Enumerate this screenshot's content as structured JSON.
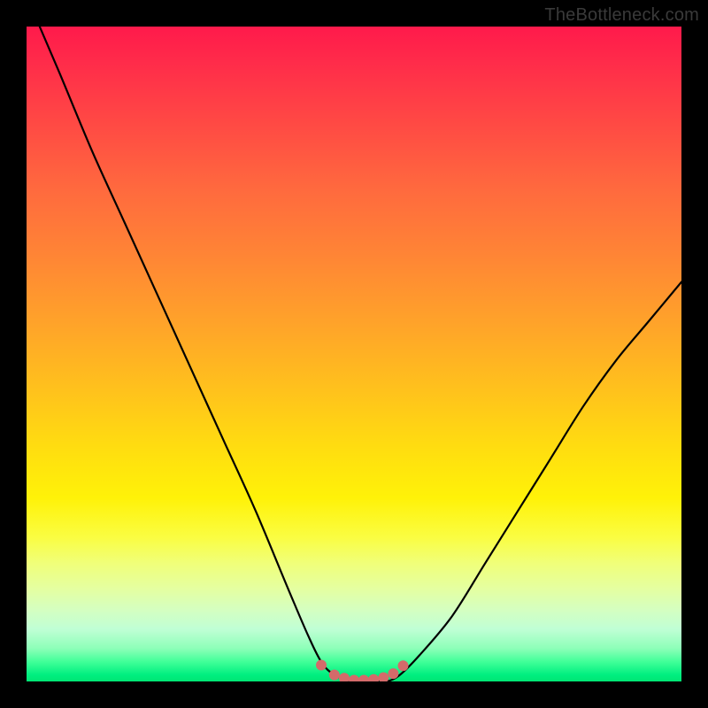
{
  "attribution": "TheBottleneck.com",
  "colors": {
    "page_bg": "#000000",
    "attribution_text": "#3a3a3a",
    "curve_stroke": "#000000",
    "marker_fill": "#d46a6a",
    "gradient_top": "#ff1a4b",
    "gradient_mid": "#ffe000",
    "gradient_bottom": "#00e573"
  },
  "chart_data": {
    "type": "line",
    "title": "",
    "xlabel": "",
    "ylabel": "",
    "xlim": [
      0,
      100
    ],
    "ylim": [
      0,
      100
    ],
    "grid": false,
    "legend": false,
    "annotations": [
      "TheBottleneck.com"
    ],
    "series": [
      {
        "name": "bottleneck-curve",
        "x": [
          2,
          5,
          10,
          15,
          20,
          25,
          30,
          35,
          40,
          43,
          45,
          47,
          50,
          53,
          55,
          57,
          60,
          65,
          70,
          75,
          80,
          85,
          90,
          95,
          100
        ],
        "y": [
          100,
          93,
          81,
          70,
          59,
          48,
          37,
          26,
          14,
          7,
          3,
          1,
          0,
          0,
          0,
          1,
          4,
          10,
          18,
          26,
          34,
          42,
          49,
          55,
          61
        ]
      }
    ],
    "markers": {
      "name": "valley-markers",
      "x": [
        45,
        47,
        48.5,
        50,
        51.5,
        53,
        54.5,
        56,
        57.5
      ],
      "y": [
        2.5,
        1,
        0.5,
        0.2,
        0.2,
        0.3,
        0.6,
        1.2,
        2.4
      ]
    }
  }
}
